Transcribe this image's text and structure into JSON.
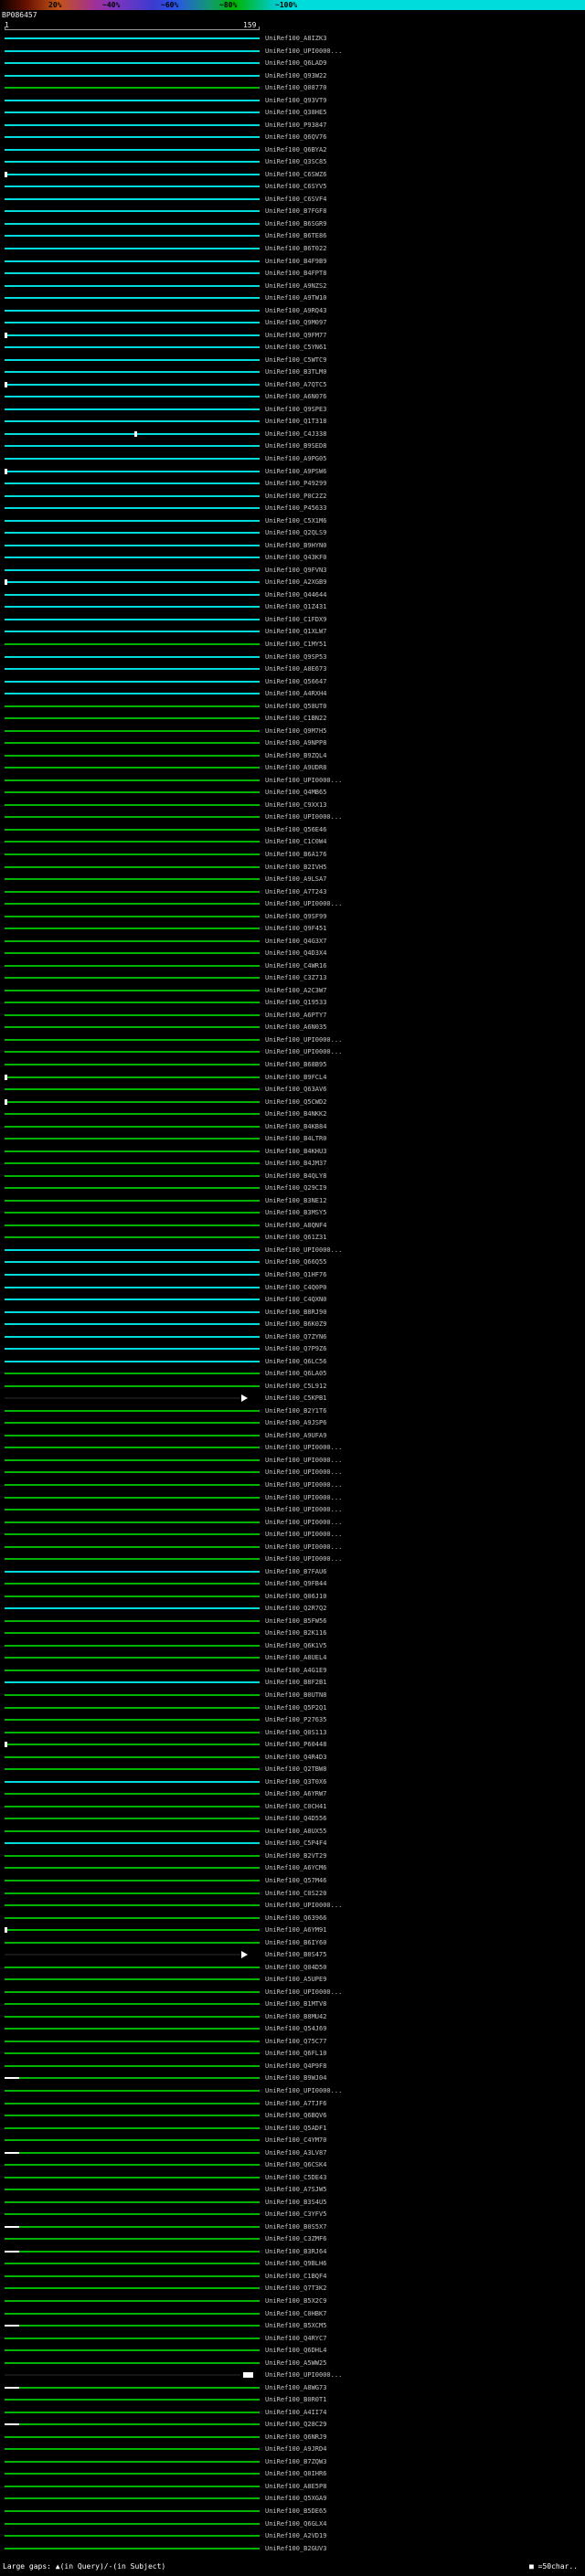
{
  "scale": {
    "labels": [
      "20%",
      "~40%",
      "~60%",
      "~80%",
      "~100%"
    ]
  },
  "query": {
    "id": "BP086457",
    "ruler_start": "1",
    "ruler_end": "159"
  },
  "footer": {
    "left": "Large gaps: ▲(in Query)/-(in Subject)",
    "right": "■ =50char.."
  },
  "colors": {
    "cyan": "#00dcdc",
    "green": "#00b400",
    "dark": "#161616",
    "label": "#c4c4c4"
  },
  "chart_data": {
    "type": "table",
    "query_id": "BP086457",
    "query_range": [
      1,
      159
    ],
    "identity_legend": {
      "20%": "red",
      "~40%": "purple",
      "~60%": "blue",
      "~80%": "green",
      "~100%": "cyan"
    },
    "marker_key": {
      "lt": "gap-in-query",
      "mt": "gap-in-query",
      "lb": "gap-in-subject",
      "ar": "large-gap-arrow",
      "bx": "50char-gap-box"
    },
    "hits": [
      {
        "l": "UniRef100_A8IZK3",
        "c": "cyan"
      },
      {
        "l": "UniRef100_UPI0000...",
        "c": "cyan"
      },
      {
        "l": "UniRef100_Q6LAD9",
        "c": "cyan"
      },
      {
        "l": "UniRef100_Q93W22",
        "c": "cyan"
      },
      {
        "l": "UniRef100_Q08770",
        "c": "green"
      },
      {
        "l": "UniRef100_Q93VT9",
        "c": "cyan"
      },
      {
        "l": "UniRef100_Q38HE5",
        "c": "cyan"
      },
      {
        "l": "UniRef100_P93847",
        "c": "cyan"
      },
      {
        "l": "UniRef100_Q6QV76",
        "c": "cyan"
      },
      {
        "l": "UniRef100_Q6BYA2",
        "c": "cyan"
      },
      {
        "l": "UniRef100_Q3SC85",
        "c": "cyan"
      },
      {
        "l": "UniRef100_C6SWZ6",
        "c": "cyan",
        "m": "lt"
      },
      {
        "l": "UniRef100_C6SYV5",
        "c": "cyan"
      },
      {
        "l": "UniRef100_C6SVF4",
        "c": "cyan"
      },
      {
        "l": "UniRef100_B7FGF8",
        "c": "cyan"
      },
      {
        "l": "UniRef100_B6SGR9",
        "c": "cyan"
      },
      {
        "l": "UniRef100_B6TE86",
        "c": "cyan"
      },
      {
        "l": "UniRef100_B6T022",
        "c": "cyan"
      },
      {
        "l": "UniRef100_B4F9B9",
        "c": "cyan"
      },
      {
        "l": "UniRef100_B4FPT8",
        "c": "cyan"
      },
      {
        "l": "UniRef100_A9NZS2",
        "c": "cyan"
      },
      {
        "l": "UniRef100_A9TW10",
        "c": "cyan"
      },
      {
        "l": "UniRef100_A9RQ43",
        "c": "cyan"
      },
      {
        "l": "UniRef100_Q9M097",
        "c": "cyan"
      },
      {
        "l": "UniRef100_Q9FM77",
        "c": "cyan",
        "m": "lt"
      },
      {
        "l": "UniRef100_C5YN61",
        "c": "cyan"
      },
      {
        "l": "UniRef100_C5WTC9",
        "c": "cyan"
      },
      {
        "l": "UniRef100_B3TLM0",
        "c": "cyan"
      },
      {
        "l": "UniRef100_A7QTC5",
        "c": "cyan",
        "m": "lt"
      },
      {
        "l": "UniRef100_A6N076",
        "c": "cyan"
      },
      {
        "l": "UniRef100_Q9SPE3",
        "c": "cyan"
      },
      {
        "l": "UniRef100_Q1T318",
        "c": "cyan"
      },
      {
        "l": "UniRef100_C4J338",
        "c": "cyan",
        "m": "mt"
      },
      {
        "l": "UniRef100_B9SED8",
        "c": "cyan"
      },
      {
        "l": "UniRef100_A9PG05",
        "c": "cyan"
      },
      {
        "l": "UniRef100_A9PSW6",
        "c": "cyan",
        "m": "lt"
      },
      {
        "l": "UniRef100_P49299",
        "c": "cyan"
      },
      {
        "l": "UniRef100_P0C2Z2",
        "c": "cyan"
      },
      {
        "l": "UniRef100_P45633",
        "c": "cyan"
      },
      {
        "l": "UniRef100_C5X1M6",
        "c": "cyan"
      },
      {
        "l": "UniRef100_Q2QLS9",
        "c": "cyan"
      },
      {
        "l": "UniRef100_B9HYN0",
        "c": "cyan"
      },
      {
        "l": "UniRef100_Q43KF0",
        "c": "cyan"
      },
      {
        "l": "UniRef100_Q9FVN3",
        "c": "cyan"
      },
      {
        "l": "UniRef100_A2XGB9",
        "c": "cyan",
        "m": "lt"
      },
      {
        "l": "UniRef100_Q44644",
        "c": "cyan"
      },
      {
        "l": "UniRef100_Q1Z431",
        "c": "cyan"
      },
      {
        "l": "UniRef100_C1FDX9",
        "c": "cyan"
      },
      {
        "l": "UniRef100_Q1XLW7",
        "c": "cyan"
      },
      {
        "l": "UniRef100_C1MY51",
        "c": "green"
      },
      {
        "l": "UniRef100_Q9SP53",
        "c": "cyan"
      },
      {
        "l": "UniRef100_A8E673",
        "c": "cyan"
      },
      {
        "l": "UniRef100_Q56647",
        "c": "cyan"
      },
      {
        "l": "UniRef100_A4RXH4",
        "c": "cyan"
      },
      {
        "l": "UniRef100_Q58UT0",
        "c": "green"
      },
      {
        "l": "UniRef100_C1BN22",
        "c": "green"
      },
      {
        "l": "UniRef100_Q9M7H5",
        "c": "green"
      },
      {
        "l": "UniRef100_A9NPP8",
        "c": "green"
      },
      {
        "l": "UniRef100_B9ZQL4",
        "c": "green"
      },
      {
        "l": "UniRef100_A9UDR8",
        "c": "green"
      },
      {
        "l": "UniRef100_UPI0000...",
        "c": "green"
      },
      {
        "l": "UniRef100_Q4MB65",
        "c": "green"
      },
      {
        "l": "UniRef100_C9XX13",
        "c": "green"
      },
      {
        "l": "UniRef100_UPI0000...",
        "c": "green"
      },
      {
        "l": "UniRef100_Q56E46",
        "c": "green"
      },
      {
        "l": "UniRef100_C1C0W4",
        "c": "green"
      },
      {
        "l": "UniRef100_B6A176",
        "c": "green"
      },
      {
        "l": "UniRef100_B2IVH5",
        "c": "green"
      },
      {
        "l": "UniRef100_A9LSA7",
        "c": "green"
      },
      {
        "l": "UniRef100_A7T243",
        "c": "green"
      },
      {
        "l": "UniRef100_UPI0000...",
        "c": "green"
      },
      {
        "l": "UniRef100_Q9SF99",
        "c": "green"
      },
      {
        "l": "UniRef100_Q9F451",
        "c": "green"
      },
      {
        "l": "UniRef100_Q4G3X7",
        "c": "green"
      },
      {
        "l": "UniRef100_Q4D3X4",
        "c": "green"
      },
      {
        "l": "UniRef100_C4WR16",
        "c": "green"
      },
      {
        "l": "UniRef100_C3Z713",
        "c": "green"
      },
      {
        "l": "UniRef100_A2C3W7",
        "c": "green"
      },
      {
        "l": "UniRef100_Q19533",
        "c": "green"
      },
      {
        "l": "UniRef100_A6PTY7",
        "c": "green"
      },
      {
        "l": "UniRef100_A6N035",
        "c": "green"
      },
      {
        "l": "UniRef100_UPI0000...",
        "c": "green"
      },
      {
        "l": "UniRef100_UPI0000...",
        "c": "green"
      },
      {
        "l": "UniRef100_B68B95",
        "c": "green"
      },
      {
        "l": "UniRef100_B9FCL4",
        "c": "green",
        "m": "lt"
      },
      {
        "l": "UniRef100_Q63AV6",
        "c": "green"
      },
      {
        "l": "UniRef100_Q5CWD2",
        "c": "green",
        "m": "lt"
      },
      {
        "l": "UniRef100_B4NKK2",
        "c": "green"
      },
      {
        "l": "UniRef100_B4KB84",
        "c": "green"
      },
      {
        "l": "UniRef100_B4LTR0",
        "c": "green"
      },
      {
        "l": "UniRef100_B4KHU3",
        "c": "green"
      },
      {
        "l": "UniRef100_B4JM37",
        "c": "green"
      },
      {
        "l": "UniRef100_B4QLY8",
        "c": "green"
      },
      {
        "l": "UniRef100_Q29CI9",
        "c": "green"
      },
      {
        "l": "UniRef100_B3NE12",
        "c": "green"
      },
      {
        "l": "UniRef100_B3MSY5",
        "c": "green"
      },
      {
        "l": "UniRef100_A8QNF4",
        "c": "green"
      },
      {
        "l": "UniRef100_Q61Z31",
        "c": "green"
      },
      {
        "l": "UniRef100_UPI0000...",
        "c": "cyan"
      },
      {
        "l": "UniRef100_Q66Q55",
        "c": "cyan"
      },
      {
        "l": "UniRef100_Q1HF76",
        "c": "cyan"
      },
      {
        "l": "UniRef100_C4Q0P0",
        "c": "cyan"
      },
      {
        "l": "UniRef100_C4QXN0",
        "c": "cyan"
      },
      {
        "l": "UniRef100_B8RJ90",
        "c": "cyan"
      },
      {
        "l": "UniRef100_B6K0Z9",
        "c": "cyan"
      },
      {
        "l": "UniRef100_Q7ZYN6",
        "c": "cyan"
      },
      {
        "l": "UniRef100_Q7P9Z6",
        "c": "cyan"
      },
      {
        "l": "UniRef100_Q6LC56",
        "c": "cyan"
      },
      {
        "l": "UniRef100_Q6LA05",
        "c": "green"
      },
      {
        "l": "UniRef100_C5L912",
        "c": "green"
      },
      {
        "l": "UniRef100_C5KPB1",
        "c": "dark",
        "m": "ar"
      },
      {
        "l": "UniRef100_B2Y1T6",
        "c": "green"
      },
      {
        "l": "UniRef100_A9JSP6",
        "c": "green"
      },
      {
        "l": "UniRef100_A9UFA9",
        "c": "green"
      },
      {
        "l": "UniRef100_UPI0000...",
        "c": "green"
      },
      {
        "l": "UniRef100_UPI0000...",
        "c": "green"
      },
      {
        "l": "UniRef100_UPI0000...",
        "c": "green"
      },
      {
        "l": "UniRef100_UPI0000...",
        "c": "green"
      },
      {
        "l": "UniRef100_UPI0000...",
        "c": "green"
      },
      {
        "l": "UniRef100_UPI0000...",
        "c": "green"
      },
      {
        "l": "UniRef100_UPI0000...",
        "c": "green"
      },
      {
        "l": "UniRef100_UPI0000...",
        "c": "green"
      },
      {
        "l": "UniRef100_UPI0000...",
        "c": "green"
      },
      {
        "l": "UniRef100_UPI0000...",
        "c": "green"
      },
      {
        "l": "UniRef100_B7FAU6",
        "c": "cyan"
      },
      {
        "l": "UniRef100_Q9FB44",
        "c": "green"
      },
      {
        "l": "UniRef100_Q06J10",
        "c": "green"
      },
      {
        "l": "UniRef100_Q2R7Q2",
        "c": "cyan"
      },
      {
        "l": "UniRef100_B5FW56",
        "c": "green"
      },
      {
        "l": "UniRef100_B2K116",
        "c": "green"
      },
      {
        "l": "UniRef100_Q6K1V5",
        "c": "green"
      },
      {
        "l": "UniRef100_A8UEL4",
        "c": "green"
      },
      {
        "l": "UniRef100_A4G1E9",
        "c": "green"
      },
      {
        "l": "UniRef100_B8F2B1",
        "c": "cyan"
      },
      {
        "l": "UniRef100_B0UTN8",
        "c": "green"
      },
      {
        "l": "UniRef100_Q5P2Q1",
        "c": "green"
      },
      {
        "l": "UniRef100_P27635",
        "c": "green"
      },
      {
        "l": "UniRef100_Q0S113",
        "c": "green"
      },
      {
        "l": "UniRef100_P60448",
        "c": "green",
        "m": "lt"
      },
      {
        "l": "UniRef100_Q4R4D3",
        "c": "green"
      },
      {
        "l": "UniRef100_Q2TBW8",
        "c": "green"
      },
      {
        "l": "UniRef100_Q3T0X6",
        "c": "cyan"
      },
      {
        "l": "UniRef100_A6YRW7",
        "c": "green"
      },
      {
        "l": "UniRef100_C0CH41",
        "c": "green"
      },
      {
        "l": "UniRef100_Q4D556",
        "c": "green"
      },
      {
        "l": "UniRef100_A8UX55",
        "c": "green"
      },
      {
        "l": "UniRef100_C5P4F4",
        "c": "cyan"
      },
      {
        "l": "UniRef100_B2VT29",
        "c": "green"
      },
      {
        "l": "UniRef100_A6YCM6",
        "c": "green"
      },
      {
        "l": "UniRef100_Q57M46",
        "c": "green"
      },
      {
        "l": "UniRef100_C0S220",
        "c": "green"
      },
      {
        "l": "UniRef100_UPI0000...",
        "c": "green"
      },
      {
        "l": "UniRef100_Q63966",
        "c": "green"
      },
      {
        "l": "UniRef100_A6YM91",
        "c": "green",
        "m": "lt"
      },
      {
        "l": "UniRef100_B6IY60",
        "c": "green"
      },
      {
        "l": "UniRef100_B0S475",
        "c": "dark",
        "m": "ar"
      },
      {
        "l": "UniRef100_Q04D50",
        "c": "green"
      },
      {
        "l": "UniRef100_A5UPE9",
        "c": "green"
      },
      {
        "l": "UniRef100_UPI0000...",
        "c": "green"
      },
      {
        "l": "UniRef100_B1MTV8",
        "c": "green"
      },
      {
        "l": "UniRef100_B8MU42",
        "c": "green"
      },
      {
        "l": "UniRef100_Q54J69",
        "c": "green"
      },
      {
        "l": "UniRef100_Q75C77",
        "c": "green"
      },
      {
        "l": "UniRef100_Q6FL10",
        "c": "green"
      },
      {
        "l": "UniRef100_Q4P9F8",
        "c": "green"
      },
      {
        "l": "UniRef100_B9WJ04",
        "c": "green",
        "m": "lb"
      },
      {
        "l": "UniRef100_UPI0000...",
        "c": "green"
      },
      {
        "l": "UniRef100_A7TJF6",
        "c": "green"
      },
      {
        "l": "UniRef100_Q6BQV6",
        "c": "green"
      },
      {
        "l": "UniRef100_Q5ADF1",
        "c": "green"
      },
      {
        "l": "UniRef100_C4YM70",
        "c": "green"
      },
      {
        "l": "UniRef100_A3LV87",
        "c": "green",
        "m": "lb"
      },
      {
        "l": "UniRef100_Q6CSK4",
        "c": "green"
      },
      {
        "l": "UniRef100_C5DE43",
        "c": "green"
      },
      {
        "l": "UniRef100_A7SJW5",
        "c": "green"
      },
      {
        "l": "UniRef100_B3S4U5",
        "c": "green"
      },
      {
        "l": "UniRef100_C3YFV5",
        "c": "green"
      },
      {
        "l": "UniRef100_B0S5X7",
        "c": "green",
        "m": "lb"
      },
      {
        "l": "UniRef100_C3ZMF6",
        "c": "green"
      },
      {
        "l": "UniRef100_B3RJ64",
        "c": "green",
        "m": "lb"
      },
      {
        "l": "UniRef100_Q9BLH6",
        "c": "green"
      },
      {
        "l": "UniRef100_C1BQF4",
        "c": "green"
      },
      {
        "l": "UniRef100_Q7T3K2",
        "c": "green"
      },
      {
        "l": "UniRef100_B5X2C9",
        "c": "green"
      },
      {
        "l": "UniRef100_C0HBK7",
        "c": "green"
      },
      {
        "l": "UniRef100_B5XCM5",
        "c": "green",
        "m": "lb"
      },
      {
        "l": "UniRef100_Q4RYC7",
        "c": "green"
      },
      {
        "l": "UniRef100_Q6DHL4",
        "c": "green"
      },
      {
        "l": "UniRef100_A5WW25",
        "c": "green"
      },
      {
        "l": "UniRef100_UPI0000...",
        "c": "dark",
        "m": "bx"
      },
      {
        "l": "UniRef100_A8WG73",
        "c": "green",
        "m": "lb"
      },
      {
        "l": "UniRef100_B0R0T1",
        "c": "green"
      },
      {
        "l": "UniRef100_A4II74",
        "c": "green"
      },
      {
        "l": "UniRef100_Q28C29",
        "c": "green",
        "m": "lb"
      },
      {
        "l": "UniRef100_Q6NRJ9",
        "c": "green"
      },
      {
        "l": "UniRef100_A9JRD4",
        "c": "green"
      },
      {
        "l": "UniRef100_B7ZQW3",
        "c": "green"
      },
      {
        "l": "UniRef100_Q0IHR6",
        "c": "green"
      },
      {
        "l": "UniRef100_A8E5P8",
        "c": "green"
      },
      {
        "l": "UniRef100_Q5XGA9",
        "c": "green"
      },
      {
        "l": "UniRef100_B5DE65",
        "c": "green"
      },
      {
        "l": "UniRef100_Q6GLX4",
        "c": "green"
      },
      {
        "l": "UniRef100_A2VD19",
        "c": "green"
      },
      {
        "l": "UniRef100_B2GUV3",
        "c": "green"
      }
    ]
  }
}
